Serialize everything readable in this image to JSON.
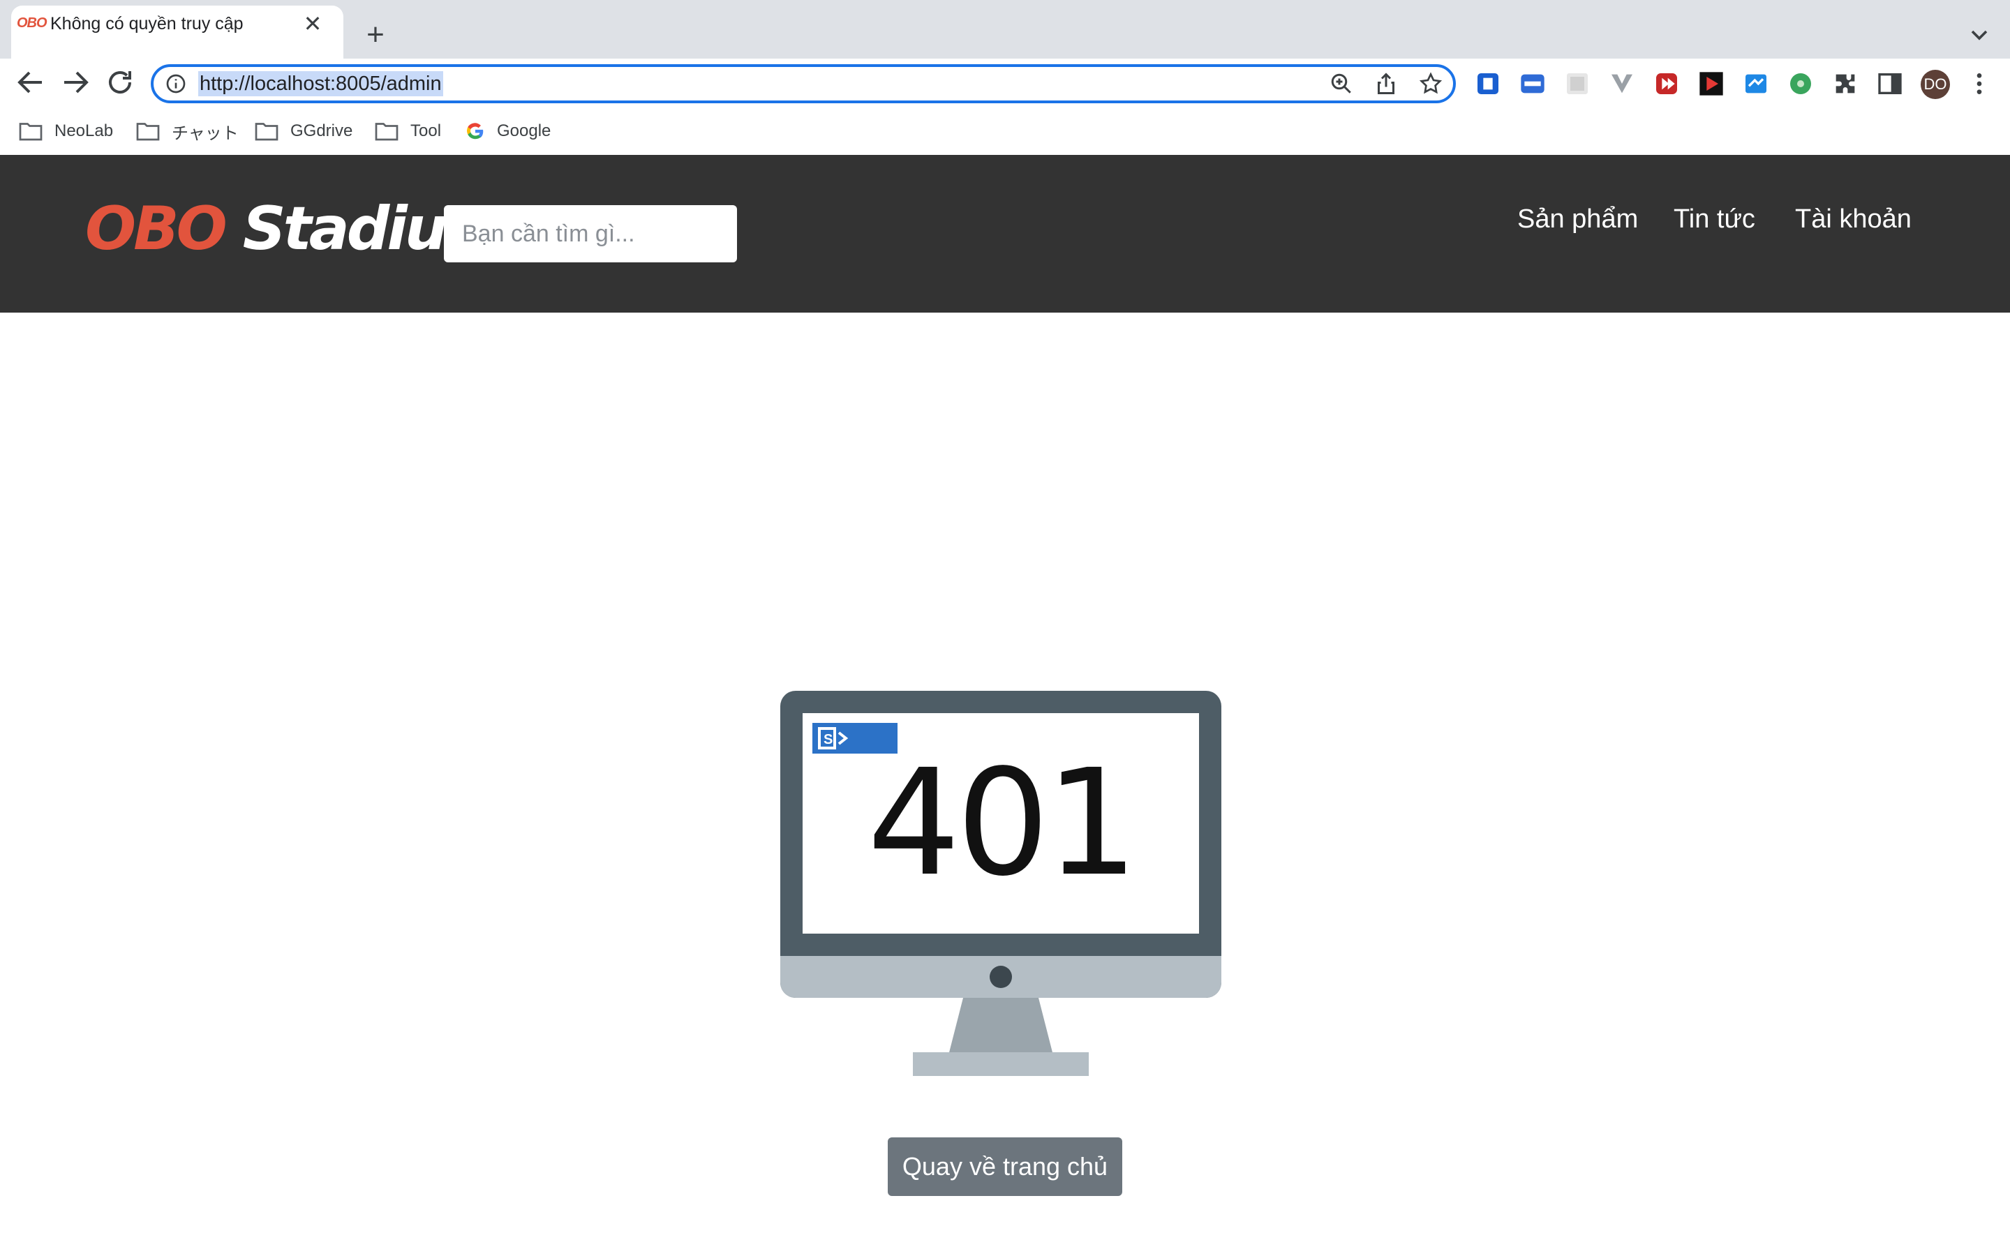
{
  "browser": {
    "tab": {
      "favicon_text": "OBO",
      "title": "Không có quyền truy cập",
      "close_glyph": "✕"
    },
    "new_tab_glyph": "+",
    "address_bar": {
      "url": "http://localhost:8005/admin"
    },
    "profile_initials": "DO",
    "bookmarks": [
      "NeoLab",
      "チャット",
      "GGdrive",
      "Tool",
      "Google"
    ]
  },
  "site": {
    "logo": {
      "part1": "OBO",
      "part2": " Stadium"
    },
    "search": {
      "placeholder": "Bạn cần tìm gì..."
    },
    "nav": [
      "Sản phẩm",
      "Tin tức",
      "Tài khoản"
    ],
    "error": {
      "code": "401",
      "home_button": "Quay về trang chủ"
    }
  },
  "colors": {
    "header_bg": "#333333",
    "brand_red": "#e2543d",
    "button_bg": "#6c757d",
    "monitor_frame": "#4e5d66",
    "monitor_stand": "#b4bec5"
  }
}
